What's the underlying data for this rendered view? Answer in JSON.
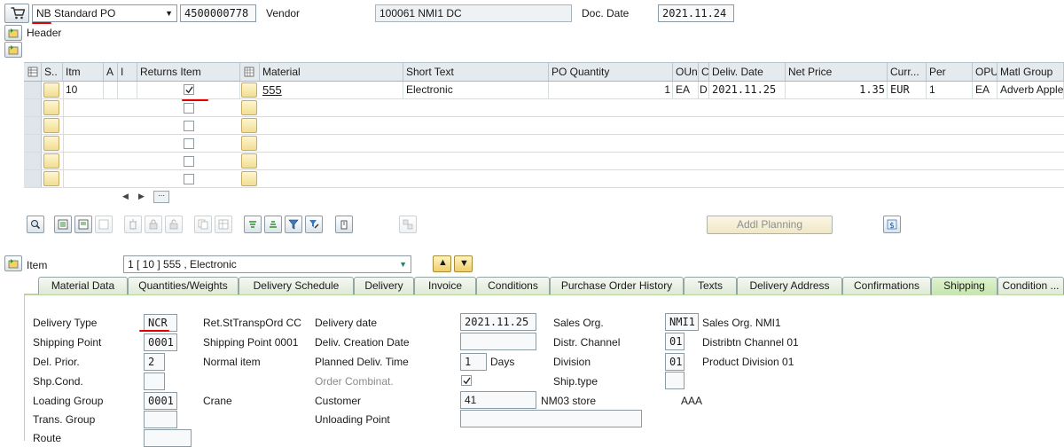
{
  "header_bar": {
    "doc_type": "NB Standard PO",
    "po_number": "4500000778",
    "vendor_label": "Vendor",
    "vendor_value": "100061 NMI1 DC",
    "doc_date_label": "Doc. Date",
    "doc_date_value": "2021.11.24"
  },
  "header_toggle_label": "Header",
  "items_table": {
    "columns": [
      "S..",
      "Itm",
      "A",
      "I",
      "Returns Item",
      "",
      "Material",
      "Short Text",
      "PO Quantity",
      "OUn",
      "C",
      "Deliv. Date",
      "Net Price",
      "Curr...",
      "Per",
      "OPU",
      "Matl Group"
    ],
    "rows": [
      {
        "itm": "10",
        "returns": true,
        "material": "555",
        "short_text": "Electronic",
        "po_quantity": "1",
        "oun": "EA",
        "c": "D",
        "deliv_date": "2021.11.25",
        "net_price": "1.35",
        "curr": "EUR",
        "per": "1",
        "opu": "EA",
        "matl_group": "Adverb Apple"
      }
    ],
    "empty_rows": 5
  },
  "toolbar": {
    "addl_planning_label": "Addl Planning"
  },
  "item_selector": {
    "label": "Item",
    "value": "1 [ 10 ] 555 , Electronic"
  },
  "tabs": [
    "Material Data",
    "Quantities/Weights",
    "Delivery Schedule",
    "Delivery",
    "Invoice",
    "Conditions",
    "Purchase Order History",
    "Texts",
    "Delivery Address",
    "Confirmations",
    "Shipping",
    "Condition ..."
  ],
  "active_tab": "Shipping",
  "shipping": {
    "delivery_type_label": "Delivery Type",
    "delivery_type_value": "NCR",
    "delivery_type_desc": "Ret.StTranspOrd CC",
    "shipping_point_label": "Shipping Point",
    "shipping_point_value": "0001",
    "shipping_point_desc": "Shipping Point 0001",
    "del_prior_label": "Del. Prior.",
    "del_prior_value": "2",
    "del_prior_desc": "Normal item",
    "shp_cond_label": "Shp.Cond.",
    "loading_group_label": "Loading Group",
    "loading_group_value": "0001",
    "loading_group_desc": "Crane",
    "trans_group_label": "Trans. Group",
    "route_label": "Route",
    "delivery_date_label": "Delivery date",
    "delivery_date_value": "2021.11.25",
    "deliv_creation_date_label": "Deliv. Creation Date",
    "planned_deliv_time_label": "Planned Deliv. Time",
    "planned_deliv_time_value": "1",
    "planned_deliv_time_unit": "Days",
    "order_combinat_label": "Order Combinat.",
    "order_combinat_checked": true,
    "customer_label": "Customer",
    "customer_value": "41",
    "customer_desc": "NM03 store",
    "customer_extra": "AAA",
    "unloading_point_label": "Unloading Point",
    "sales_org_label": "Sales Org.",
    "sales_org_value": "NMI1",
    "sales_org_desc": "Sales Org. NMI1",
    "distr_channel_label": "Distr. Channel",
    "distr_channel_value": "01",
    "distr_channel_desc": "Distribtn Channel 01",
    "division_label": "Division",
    "division_value": "01",
    "division_desc": "Product Division 01",
    "ship_type_label": "Ship.type"
  }
}
